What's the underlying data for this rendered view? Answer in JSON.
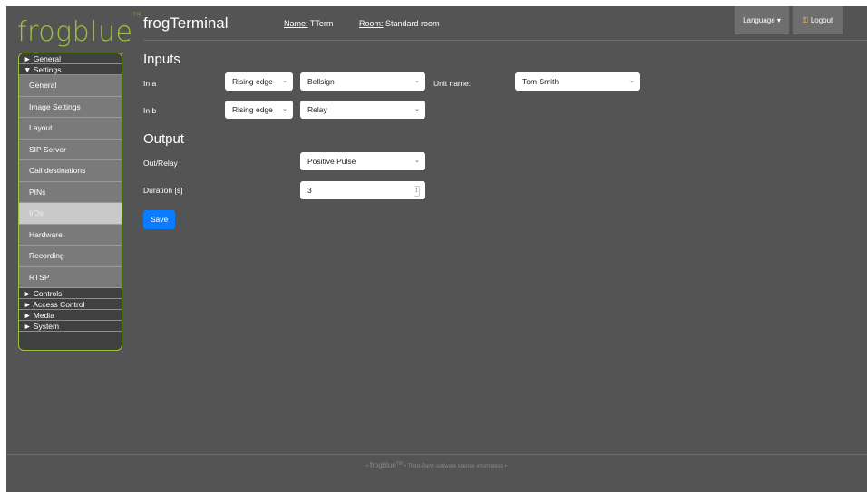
{
  "brand": {
    "logo": "frogblue",
    "tm": "TM"
  },
  "header": {
    "title": "frogTerminal",
    "name_key": "Name:",
    "name_value": "TTerm",
    "room_key": "Room:",
    "room_value": "Standard room",
    "language_label": "Language ▾",
    "logout_label": "Logout",
    "logout_icon": "key-icon"
  },
  "sidebar": {
    "general": "► General",
    "settings": "▼ Settings",
    "items": [
      "General",
      "Image Settings",
      "Layout",
      "SIP Server",
      "Call destinations",
      "PINs",
      "I/Os",
      "Hardware",
      "Recording",
      "RTSP"
    ],
    "active_item": "I/Os",
    "controls": "► Controls",
    "access_control": "► Access Control",
    "media": "► Media",
    "system": "► System"
  },
  "inputs": {
    "heading": "Inputs",
    "in_a_label": "In a",
    "in_a_edge": "Rising edge",
    "in_a_target": "Bellsign",
    "unit_name_label": "Unit name:",
    "unit_name_value": "Tom Smith",
    "in_b_label": "In b",
    "in_b_edge": "Rising edge",
    "in_b_target": "Relay"
  },
  "output": {
    "heading": "Output",
    "out_relay_label": "Out/Relay",
    "out_relay_value": "Positive Pulse",
    "duration_label": "Duration [s]",
    "duration_value": "3"
  },
  "save_label": "Save",
  "footer": {
    "brand": "frogblue",
    "tm": "TM",
    "link": "Third-Party software license information"
  },
  "colors": {
    "accent_green": "#9bc43a",
    "save_blue": "#0a7cff",
    "background": "#545454"
  }
}
